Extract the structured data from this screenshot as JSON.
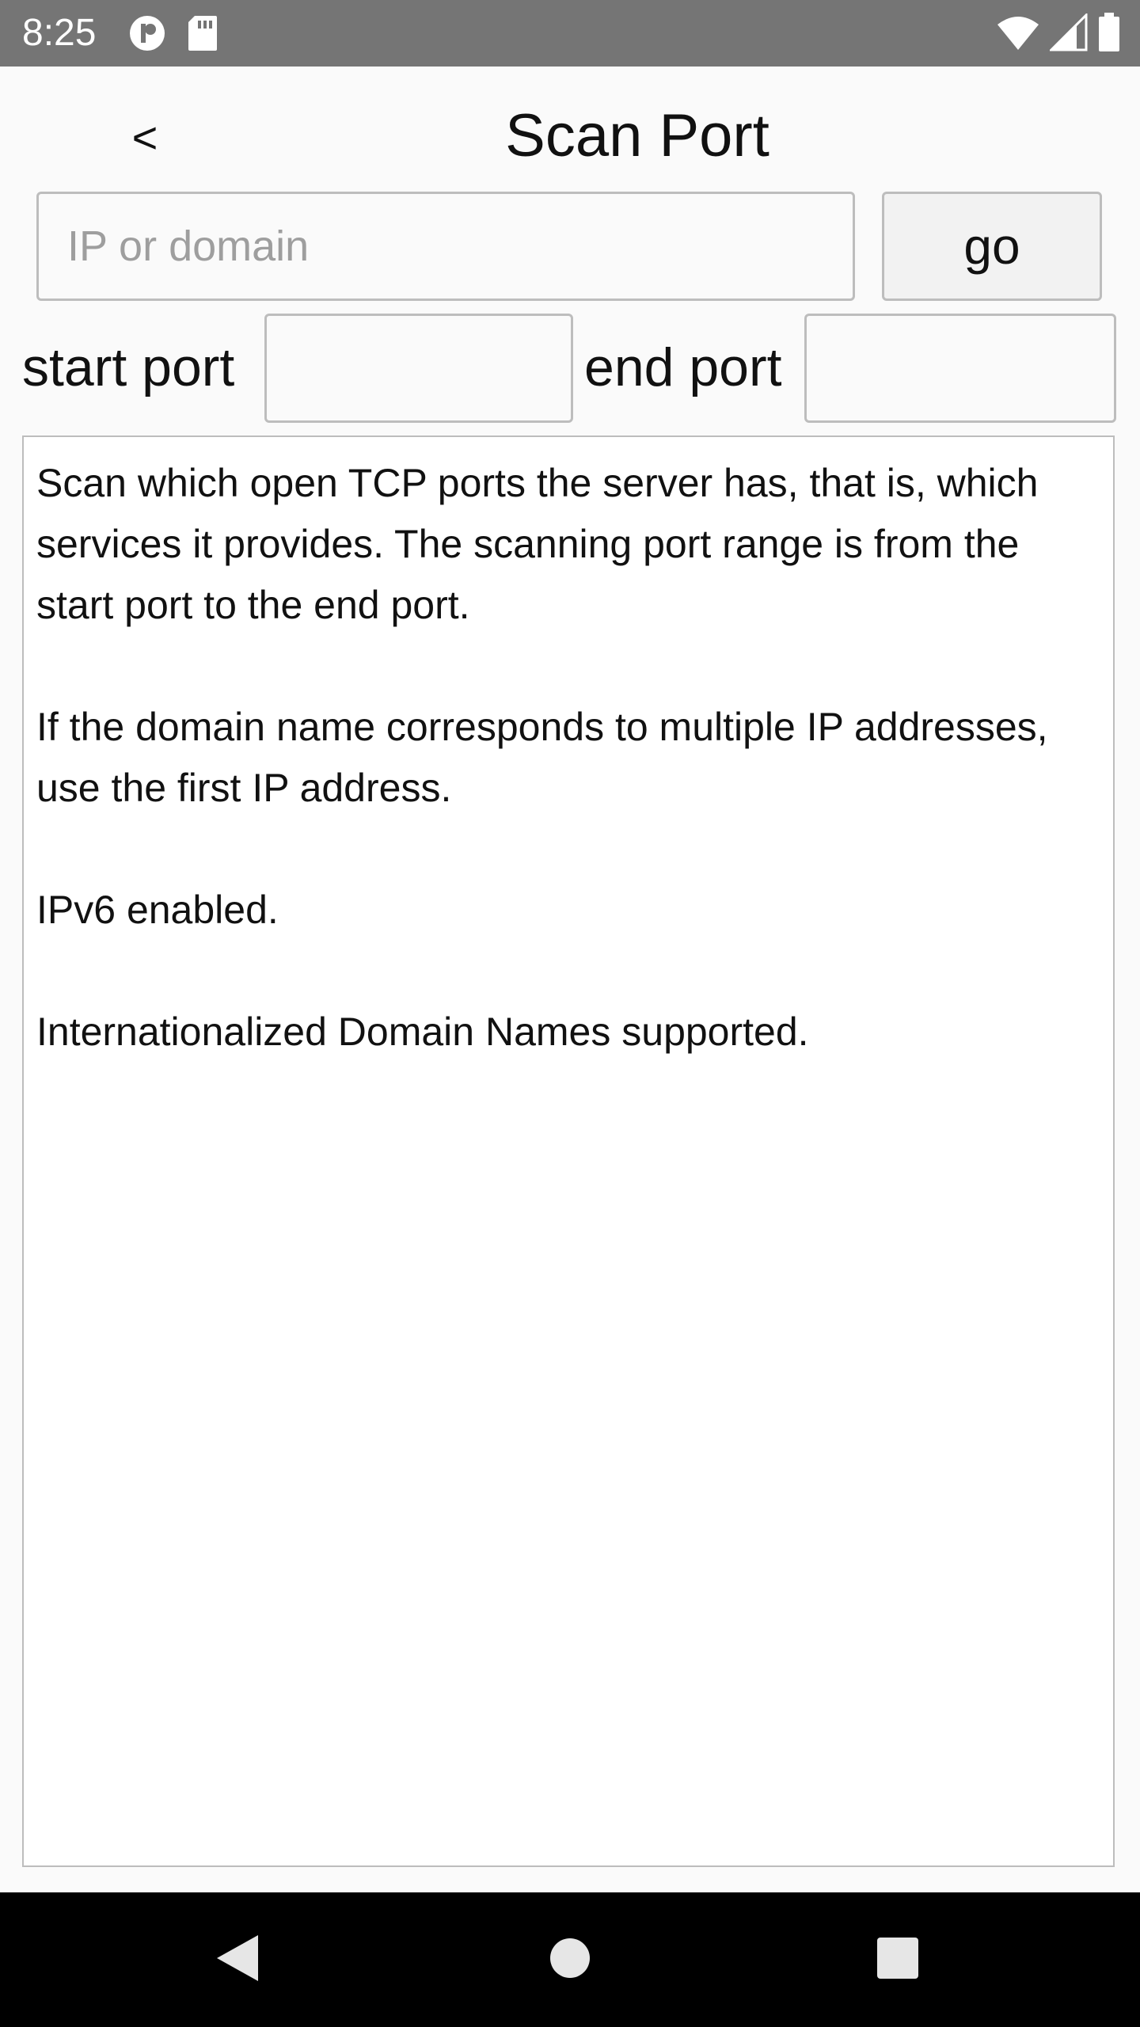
{
  "status_bar": {
    "time": "8:25",
    "icons": [
      "app-notification-icon",
      "sd-card-icon",
      "wifi-icon",
      "cell-signal-icon",
      "battery-icon"
    ]
  },
  "header": {
    "back_label": "<",
    "title": "Scan Port"
  },
  "form": {
    "ip_placeholder": "IP or domain",
    "ip_value": "",
    "go_label": "go",
    "start_port_label": "start port",
    "start_port_value": "",
    "end_port_label": "end port",
    "end_port_value": ""
  },
  "result": {
    "paragraphs": [
      "Scan which open TCP ports the server has, that is, which services it provides. The scanning port range is from the start port to the end port.",
      "If the domain name corresponds to multiple IP addresses, use the first IP address.",
      "IPv6 enabled.",
      "Internationalized Domain Names supported."
    ]
  },
  "nav_bar": {
    "icons": [
      "back-triangle-icon",
      "home-circle-icon",
      "recents-square-icon"
    ]
  },
  "colors": {
    "status_bar_bg": "#757575",
    "nav_bar_bg": "#000000",
    "border": "#bdbdbd",
    "placeholder": "#9e9e9e"
  }
}
